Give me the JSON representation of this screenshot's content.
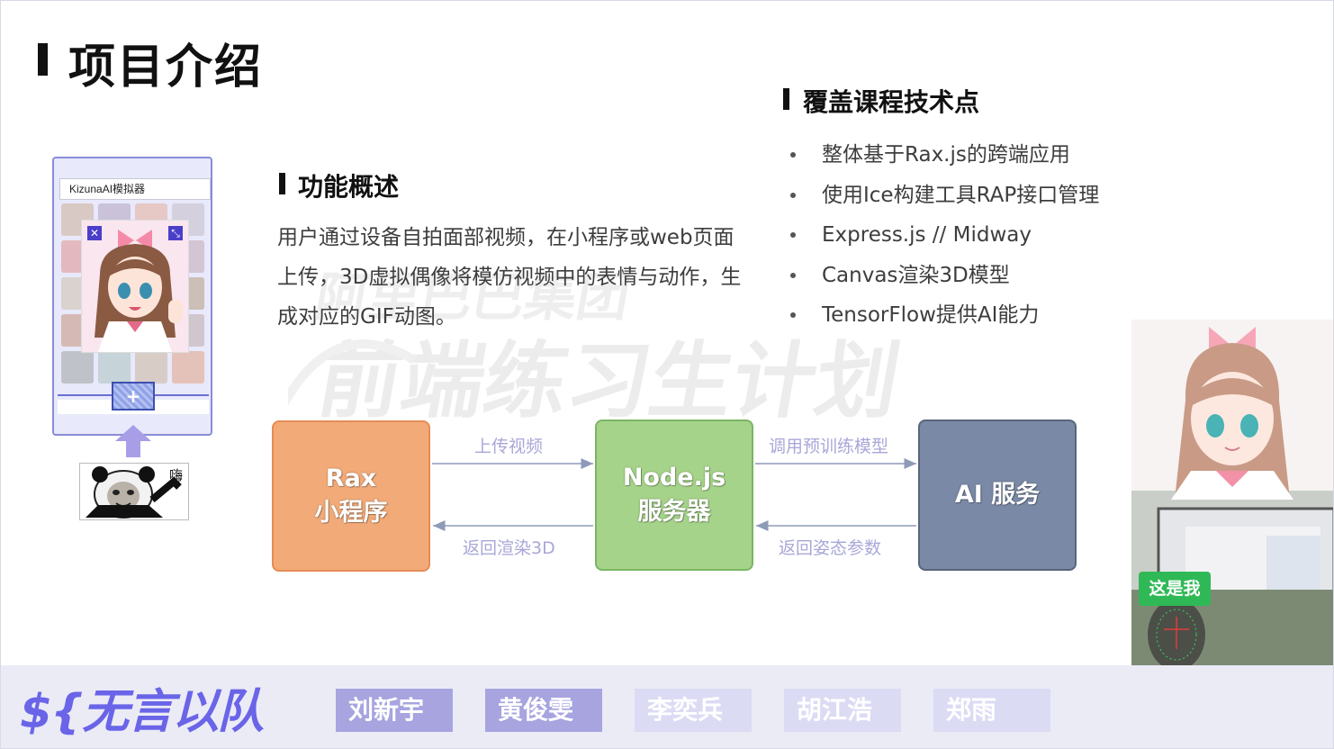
{
  "title": "项目介绍",
  "function_section": {
    "heading": "功能概述",
    "description": "用户通过设备自拍面部视频，在小程序或web页面上传，3D虚拟偶像将模仿视频中的表情与动作，生成对应的GIF动图。"
  },
  "tech_section": {
    "heading": "覆盖课程技术点",
    "items": [
      "整体基于Rax.js的跨端应用",
      "使用Ice构建工具RAP接口管理",
      "Express.js // Midway",
      "Canvas渲染3D模型",
      "TensorFlow提供AI能力"
    ]
  },
  "phone_mock": {
    "app_title": "KizunaAI模拟器",
    "close_icon": "close-icon",
    "expand_icon": "expand-icon",
    "add_label": "+",
    "meme_text": "嗨"
  },
  "watermark": {
    "line1": "阿里巴巴集团",
    "line2": "前端练习生计划"
  },
  "flow": {
    "nodes": [
      {
        "line1": "Rax",
        "line2": "小程序"
      },
      {
        "line1": "Node.js",
        "line2": "服务器"
      },
      {
        "line1": "AI 服务",
        "line2": ""
      }
    ],
    "edges": {
      "upload": "上传视频",
      "return_render": "返回渲染3D",
      "call_model": "调用预训练模型",
      "return_pose": "返回姿态参数"
    }
  },
  "webcam": {
    "badge": "这是我"
  },
  "footer": {
    "team_name": "${无言以队",
    "members": [
      "刘新宇",
      "黄俊雯",
      "李奕兵",
      "胡江浩",
      "郑雨"
    ]
  },
  "colors": {
    "rax_node": "#f2ab78",
    "node_node": "#a6d38a",
    "ai_node": "#7a8aa6",
    "accent": "#6a64e8",
    "edge_label": "#a8a7d8",
    "badge": "#2fb956"
  }
}
